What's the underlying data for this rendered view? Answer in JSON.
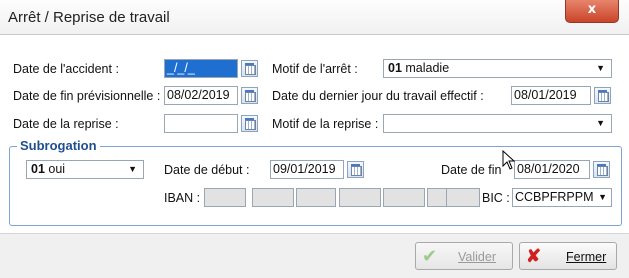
{
  "window": {
    "title": "Arrêt / Reprise de travail",
    "close": "x"
  },
  "labels": {
    "date_accident": "Date de l'accident :",
    "motif_arret": "Motif de l'arrêt :",
    "date_fin_prev": "Date de fin prévisionnelle :",
    "date_dernier_jour": "Date du dernier jour du travail effectif :",
    "date_reprise": "Date de la reprise :",
    "motif_reprise": "Motif de la reprise :"
  },
  "fields": {
    "date_accident": "_/_/_",
    "motif_arret_code": "01",
    "motif_arret_text": "maladie",
    "date_fin_prev": "08/02/2019",
    "date_dernier_jour": "08/01/2019",
    "date_reprise": "",
    "motif_reprise": ""
  },
  "subrogation": {
    "title": "Subrogation",
    "choice_code": "01",
    "choice_text": "oui",
    "date_debut_label": "Date de début :",
    "date_debut": "09/01/2019",
    "date_fin_label": "Date de fin",
    "date_fin": "08/01/2020",
    "iban_label": "IBAN :",
    "bic_label": "BIC :",
    "bic": "CCBPFRPPM"
  },
  "buttons": {
    "valider": "Valider",
    "fermer": "Fermer"
  },
  "icons": {
    "valider": "check-icon",
    "fermer": "x-icon",
    "dropdown": "chevron-down-icon",
    "calendar": "calendar-icon"
  }
}
